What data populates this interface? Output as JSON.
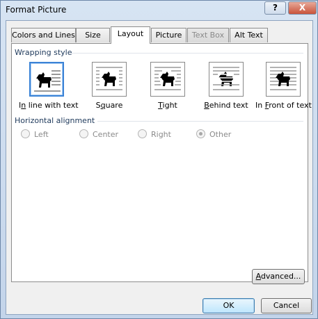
{
  "window": {
    "title": "Format Picture",
    "help_label": "?",
    "close_label": "X"
  },
  "tabs": [
    {
      "label": "Colors and Lines",
      "state": "normal"
    },
    {
      "label": "Size",
      "state": "normal"
    },
    {
      "label": "Layout",
      "state": "active"
    },
    {
      "label": "Picture",
      "state": "normal"
    },
    {
      "label": "Text Box",
      "state": "disabled"
    },
    {
      "label": "Alt Text",
      "state": "normal"
    }
  ],
  "layout": {
    "wrapping_title": "Wrapping style",
    "wrapping_options": [
      {
        "pre": "I",
        "key": "n",
        "post": " line with text",
        "selected": true
      },
      {
        "pre": "S",
        "key": "q",
        "post": "uare",
        "selected": false
      },
      {
        "pre": "",
        "key": "T",
        "post": "ight",
        "selected": false
      },
      {
        "pre": "",
        "key": "B",
        "post": "ehind text",
        "selected": false
      },
      {
        "pre": "In ",
        "key": "F",
        "post": "ront of text",
        "selected": false
      }
    ],
    "alignment_title": "Horizontal alignment",
    "alignment_options": [
      {
        "label": "Left",
        "checked": false
      },
      {
        "label": "Center",
        "checked": false
      },
      {
        "label": "Right",
        "checked": false
      },
      {
        "label": "Other",
        "checked": true
      }
    ],
    "advanced_pre": "",
    "advanced_key": "A",
    "advanced_post": "dvanced..."
  },
  "footer": {
    "ok_label": "OK",
    "cancel_label": "Cancel"
  }
}
